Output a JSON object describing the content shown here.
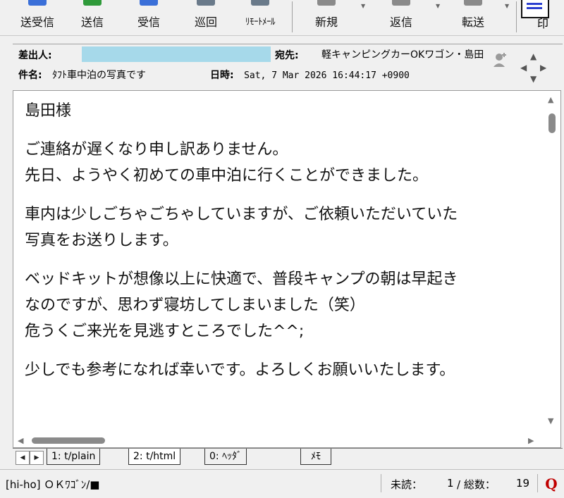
{
  "toolbar": {
    "buttons": [
      {
        "label": "送受信",
        "icon": "send-receive-icon",
        "color": "#3a6fd8"
      },
      {
        "label": "送信",
        "icon": "send-icon",
        "color": "#2f9a3a"
      },
      {
        "label": "受信",
        "icon": "receive-icon",
        "color": "#3a6fd8"
      },
      {
        "label": "巡回",
        "icon": "patrol-icon",
        "color": "#6a7a8a"
      },
      {
        "label": "ﾘﾓｰﾄﾒｰﾙ",
        "icon": "remote-mail-icon",
        "color": "#6a7a8a"
      },
      {
        "label": "新規",
        "icon": "new-mail-icon",
        "color": "#8a8a8a"
      },
      {
        "label": "返信",
        "icon": "reply-icon",
        "color": "#8a8a8a"
      },
      {
        "label": "転送",
        "icon": "forward-icon",
        "color": "#8a8a8a"
      },
      {
        "label": "印",
        "icon": "print-icon",
        "color": "#2b3fd0"
      }
    ]
  },
  "header": {
    "from_label": "差出人:",
    "from_value": "",
    "to_label": "宛先:",
    "to_value": "軽キャンピングカーOKワゴン・島田",
    "subject_label": "件名:",
    "subject_value": "ﾀﾌﾄ車中泊の写真です",
    "date_label": "日時:",
    "date_value": "Sat, 7 Mar 2026 16:44:17 +0900"
  },
  "body": {
    "paragraphs": [
      [
        "島田様"
      ],
      [
        "ご連絡が遅くなり申し訳ありません。",
        "先日、ようやく初めての車中泊に行くことができました。"
      ],
      [
        "車内は少しごちゃごちゃしていますが、ご依頼いただいていた",
        "写真をお送りします。"
      ],
      [
        "ベッドキットが想像以上に快適で、普段キャンプの朝は早起き",
        "なのですが、思わず寝坊してしまいました（笑）",
        "危うくご来光を見逃すところでした^^;"
      ],
      [
        "少しでも参考になれば幸いです。よろしくお願いいたします。"
      ]
    ]
  },
  "tabs": [
    {
      "label": "1: t/plain",
      "active": false
    },
    {
      "label": "2: t/html",
      "active": true
    },
    {
      "label": "0: ﾍｯﾀﾞ",
      "active": false
    },
    {
      "label": "ﾒﾓ",
      "active": false
    }
  ],
  "status": {
    "account": "[hi-ho] ＯＫﾜｺﾞﾝ/■",
    "unread_label": "未読：",
    "unread_value": "1",
    "total_label": "/ 総数：",
    "total_value": "19"
  }
}
